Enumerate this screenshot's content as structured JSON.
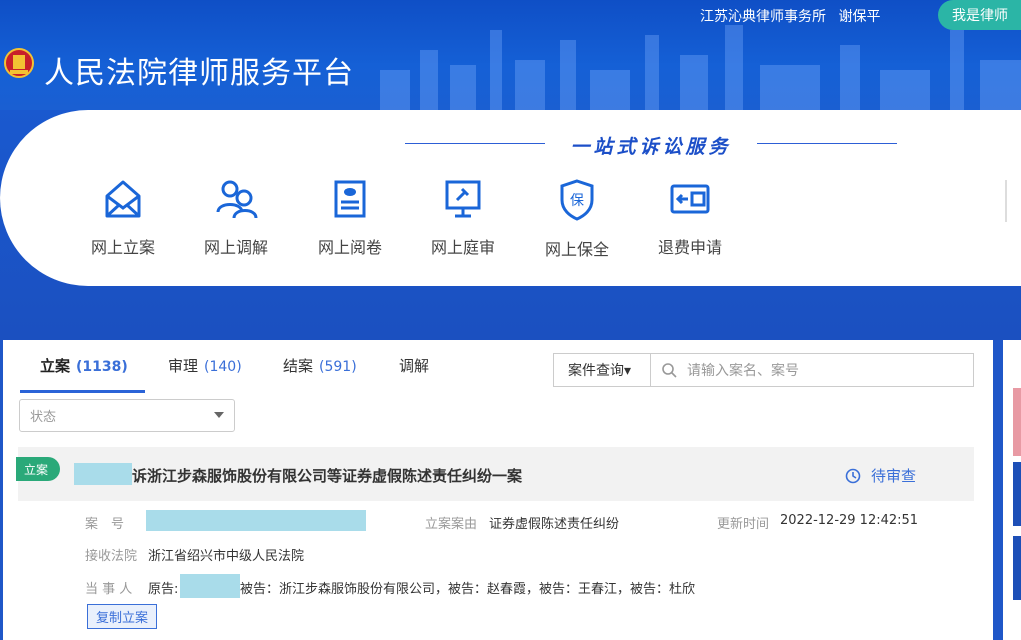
{
  "header": {
    "title": "人民法院律师服务平台",
    "firm": "江苏沁典律师事务所",
    "user": "谢保平",
    "role_button": "我是律师"
  },
  "services": {
    "title": "一站式诉讼服务",
    "items": [
      {
        "label": "网上立案",
        "icon": "envelope-icon"
      },
      {
        "label": "网上调解",
        "icon": "people-icon"
      },
      {
        "label": "网上阅卷",
        "icon": "document-icon"
      },
      {
        "label": "网上庭审",
        "icon": "gavel-screen-icon"
      },
      {
        "label": "网上保全",
        "icon": "shield-icon",
        "glyph": "保"
      },
      {
        "label": "退费申请",
        "icon": "refund-card-icon"
      }
    ]
  },
  "tabs": [
    {
      "label": "立案",
      "count": "(1138)"
    },
    {
      "label": "审理",
      "count": "(140)"
    },
    {
      "label": "结案",
      "count": "(591)"
    },
    {
      "label": "调解",
      "count": ""
    }
  ],
  "search": {
    "type_label": "案件查询▾",
    "placeholder": "请输入案名、案号"
  },
  "filter": {
    "status_placeholder": "状态"
  },
  "case": {
    "badge": "立案",
    "title": "诉浙江步森服饰股份有限公司等证券虚假陈述责任纠纷一案",
    "status": "待审查",
    "case_no_label": "案　号",
    "cause_label": "立案案由",
    "cause_value": "证券虚假陈述责任纠纷",
    "updated_label": "更新时间",
    "updated_value": "2022-12-29 12:42:51",
    "court_label": "接收法院",
    "court_value": "浙江省绍兴市中级人民法院",
    "party_label": "当 事 人",
    "plaintiff_prefix": "原告:",
    "parties_rest": "被告：浙江步森服饰股份有限公司，被告：赵春霞，被告：王春江，被告：杜欣",
    "copy_button": "复制立案"
  },
  "colors": {
    "primary_blue": "#1f57c8",
    "accent_teal": "#2bb5a6",
    "badge_green": "#2aa979",
    "link_blue": "#3a6fd8",
    "mask_blue": "#a9dcea"
  }
}
